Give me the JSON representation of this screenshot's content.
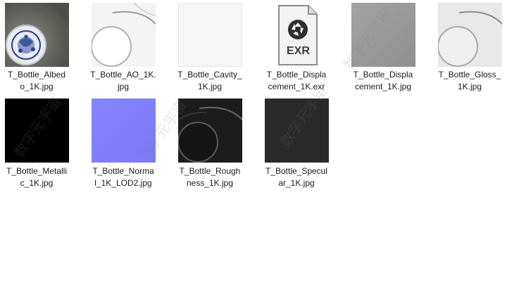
{
  "files": [
    {
      "name": "T_Bottle_Albedo_1K.jpg",
      "line1": "T_Bottle_Albed",
      "line2": "o_1K.jpg",
      "thumb": "albedo-thumbnail"
    },
    {
      "name": "T_Bottle_AO_1K.jpg",
      "line1": "T_Bottle_AO_1K.",
      "line2": "jpg",
      "thumb": "ao-thumbnail"
    },
    {
      "name": "T_Bottle_Cavity_1K.jpg",
      "line1": "T_Bottle_Cavity_",
      "line2": "1K.jpg",
      "thumb": "cavity-thumbnail"
    },
    {
      "name": "T_Bottle_Displacement_1K.exr",
      "line1": "T_Bottle_Displa",
      "line2": "cement_1K.exr",
      "thumb": "exr-file-icon",
      "icon_label": "EXR"
    },
    {
      "name": "T_Bottle_Displacement_1K.jpg",
      "line1": "T_Bottle_Displa",
      "line2": "cement_1K.jpg",
      "thumb": "displacement-thumbnail"
    },
    {
      "name": "T_Bottle_Gloss_1K.jpg",
      "line1": "T_Bottle_Gloss_",
      "line2": "1K.jpg",
      "thumb": "gloss-thumbnail"
    },
    {
      "name": "T_Bottle_Metallic_1K.jpg",
      "line1": "T_Bottle_Metalli",
      "line2": "c_1K.jpg",
      "thumb": "metallic-thumbnail"
    },
    {
      "name": "T_Bottle_Normal_1K_LOD2.jpg",
      "line1": "T_Bottle_Norma",
      "line2": "l_1K_LOD2.jpg",
      "thumb": "normal-thumbnail"
    },
    {
      "name": "T_Bottle_Roughness_1K.jpg",
      "line1": "T_Bottle_Rough",
      "line2": "ness_1K.jpg",
      "thumb": "roughness-thumbnail"
    },
    {
      "name": "T_Bottle_Specular_1K.jpg",
      "line1": "T_Bottle_Specul",
      "line2": "ar_1K.jpg",
      "thumb": "specular-thumbnail"
    }
  ],
  "watermark_text": "数字元宇宙",
  "colors": {
    "background": "#ffffff",
    "label_text": "#1a1a1a",
    "metallic": "#000000",
    "normal": "#8080ff",
    "roughness": "#1c1c1c",
    "specular": "#2a2a2a",
    "displacement": "#9a9a9a",
    "exr_icon_bg": "#3c3c3c"
  }
}
